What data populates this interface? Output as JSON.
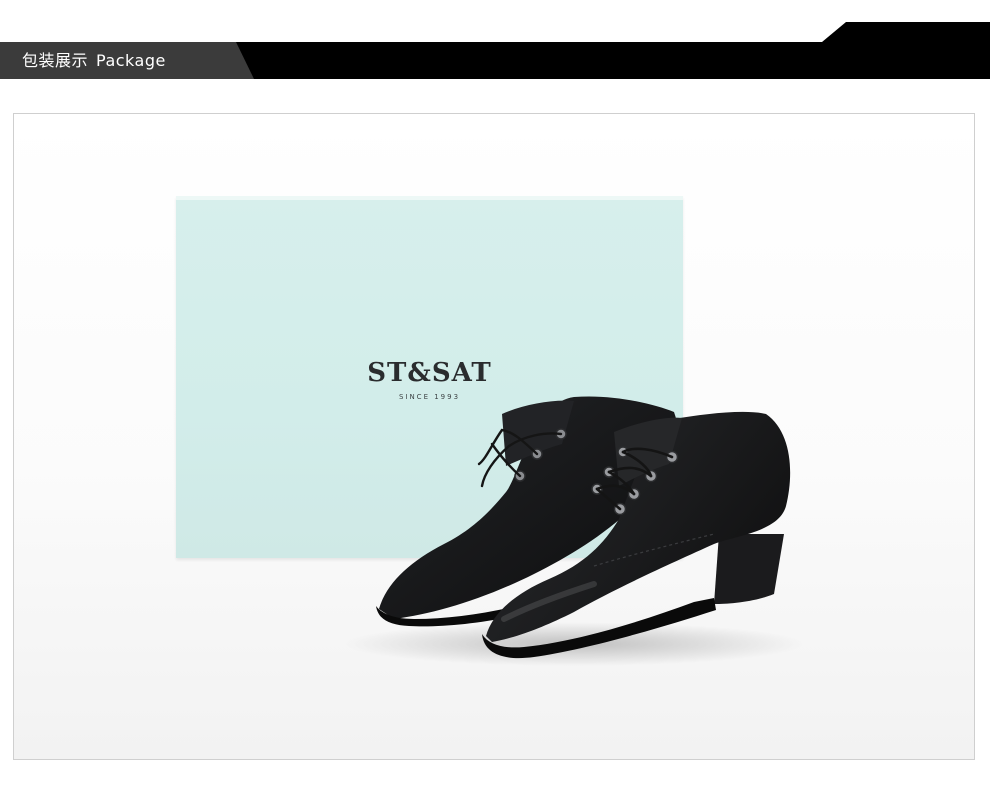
{
  "header": {
    "title_cn": "包装展示",
    "title_en": "Package"
  },
  "box": {
    "brand": "ST&SAT",
    "tagline": "SINCE 1993"
  },
  "colors": {
    "banner_black": "#000000",
    "banner_grey": "#3b3b3b",
    "box_mint": "#d3eeeb",
    "shoe_leather": "#1a1a1c",
    "frame_border": "#cfcfcf"
  }
}
